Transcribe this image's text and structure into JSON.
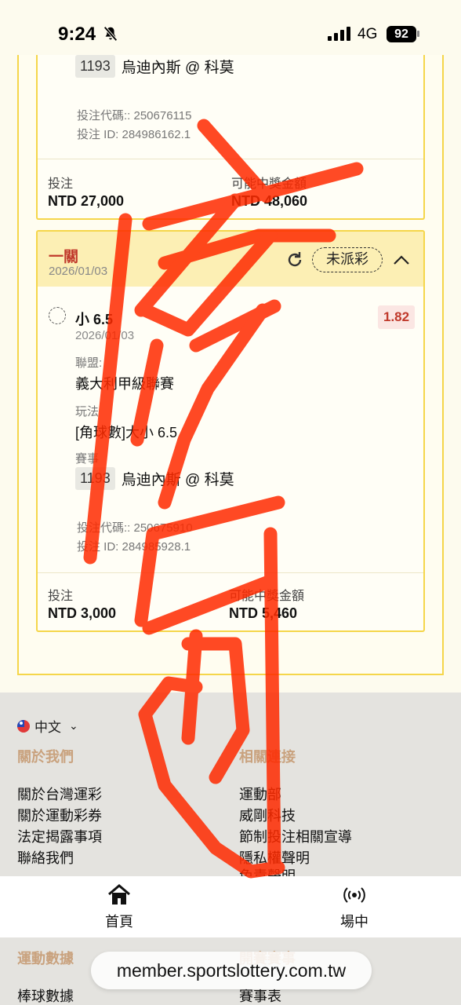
{
  "status_bar": {
    "time": "9:24",
    "network": "4G",
    "battery": "92"
  },
  "bet1": {
    "team_id": "1193",
    "match": "烏迪內斯 @ 科莫",
    "bet_code": "投注代碼:: 250676115",
    "bet_id": "投注 ID: 284986162.1",
    "stake_label": "投注",
    "stake_value": "NTD 27,000",
    "payout_label": "可能中獎金額",
    "payout_value": "NTD 48,060"
  },
  "bet2": {
    "title": "一關",
    "date": "2026/01/03",
    "status": "未派彩",
    "selection": "小 6.5",
    "selection_date": "2026/01/03",
    "odds": "1.82",
    "league_label": "聯盟:",
    "league_value": "義大利甲級聯賽",
    "play_label": "玩法",
    "play_value": "[角球數]大小 6.5",
    "event_label": "賽事",
    "team_id": "1193",
    "match": "烏迪內斯 @ 科莫",
    "bet_code": "投注代碼:: 250675910",
    "bet_id": "投注 ID: 284985928.1",
    "stake_label": "投注",
    "stake_value": "NTD 3,000",
    "payout_label": "可能中獎金額",
    "payout_value": "NTD 5,460"
  },
  "footer": {
    "language": "中文",
    "about_heading": "關於我們",
    "about_links": [
      "關於台灣運彩",
      "關於運動彩券",
      "法定揭露事項",
      "聯絡我們"
    ],
    "related_heading": "相關連接",
    "related_links": [
      "運動部",
      "威剛科技",
      "節制投注相關宣導",
      "隱私權聲明",
      "免責聲明"
    ],
    "stats_heading": "運動數據",
    "stats_links": [
      "棒球數據"
    ],
    "other_heading": "開賽賽事",
    "other_links": [
      "賽事表"
    ]
  },
  "tabbar": {
    "home": "首頁",
    "live": "場中"
  },
  "url": "member.sportslottery.com.tw",
  "colors": {
    "accent": "#f5d64a",
    "red": "#c0392b",
    "scribble": "#ff2a00"
  }
}
